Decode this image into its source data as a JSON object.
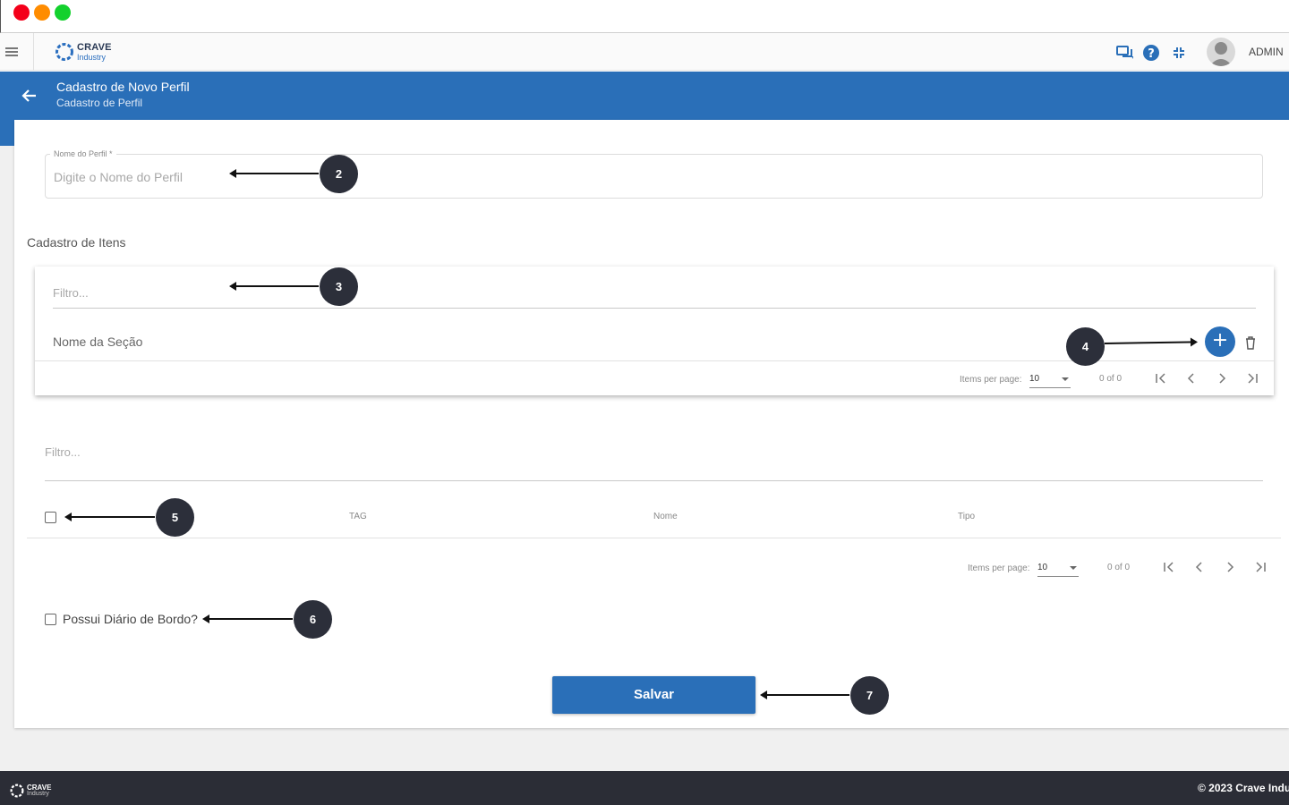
{
  "app": {
    "logo_line1": "CRAVE",
    "logo_line2": "Industry",
    "user_name": "ADMIN"
  },
  "header_icons": [
    "chat-icon",
    "help-icon",
    "collapse-icon"
  ],
  "banner": {
    "title": "Cadastro de Novo Perfil",
    "subtitle": "Cadastro de Perfil"
  },
  "profile_name": {
    "label": "Nome do Perfil *",
    "placeholder": "Digite o Nome do Perfil",
    "value": ""
  },
  "items_section": {
    "heading": "Cadastro de Itens",
    "filter_placeholder": "Filtro...",
    "column": "Nome da Seção",
    "paginator": {
      "label": "Items per page:",
      "page_size": "10",
      "range": "0 of 0"
    }
  },
  "tags_table": {
    "filter_placeholder": "Filtro...",
    "columns": [
      "TAG",
      "Nome",
      "Tipo"
    ],
    "paginator": {
      "label": "Items per page:",
      "page_size": "10",
      "range": "0 of 0"
    }
  },
  "logbook": {
    "label": "Possui Diário de Bordo?",
    "checked": false
  },
  "save_label": "Salvar",
  "callouts": [
    "2",
    "3",
    "4",
    "5",
    "6",
    "7"
  ],
  "footer": {
    "logo_line1": "CRAVE",
    "logo_line2": "Industry",
    "copyright": "© 2023 Crave Indu"
  },
  "colors": {
    "primary": "#2a6fb8",
    "footer": "#2b2d36",
    "callout": "#2c2f3a"
  }
}
